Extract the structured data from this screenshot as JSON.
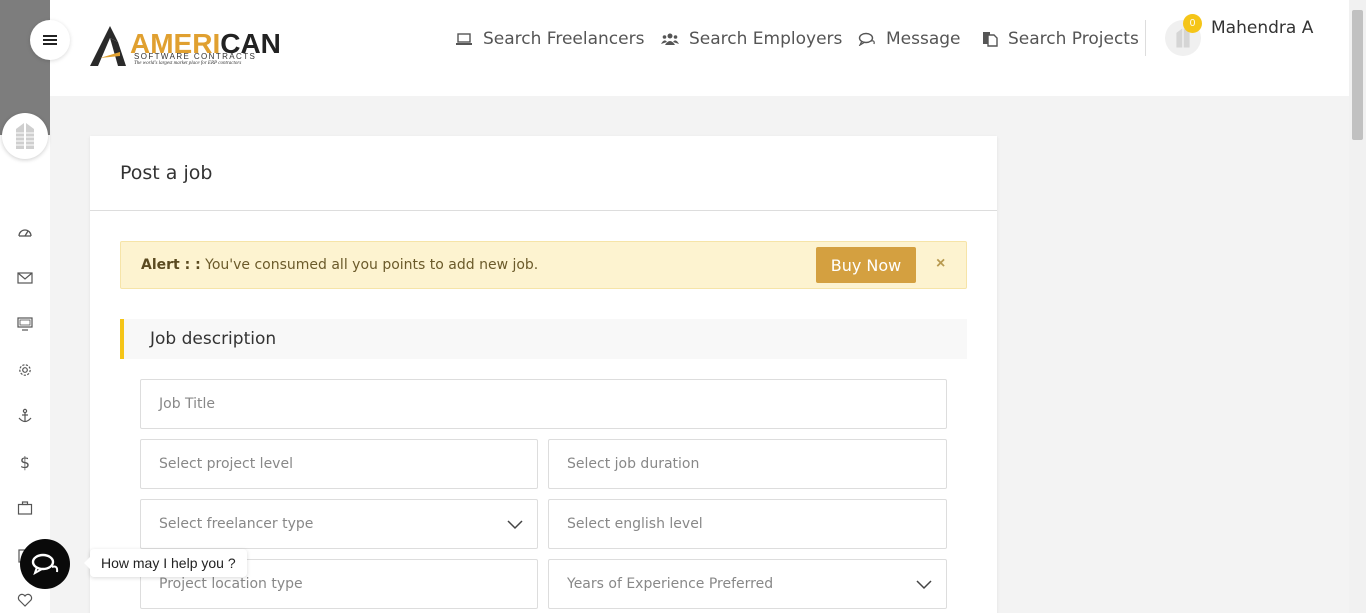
{
  "header": {
    "logo": {
      "brand_prefix": "AMERI",
      "brand_suffix": "CAN",
      "subtitle": "SOFTWARE CONTRACTS",
      "tagline": "The world's largest market place for ERP contractors"
    },
    "nav": [
      {
        "label": "Search Freelancers",
        "icon": "laptop-icon"
      },
      {
        "label": "Search Employers",
        "icon": "users-icon"
      },
      {
        "label": "Message",
        "icon": "chat-icon"
      },
      {
        "label": "Search Projects",
        "icon": "documents-icon"
      }
    ],
    "notification_count": "0",
    "user_name": "Mahendra A"
  },
  "sidebar": {
    "icons": [
      "dashboard-icon",
      "mail-icon",
      "monitor-icon",
      "gear-icon",
      "anchor-icon",
      "dollar-icon",
      "briefcase-icon",
      "document-icon",
      "heart-icon"
    ]
  },
  "card": {
    "title": "Post a job",
    "alert": {
      "prefix": "Alert : :",
      "message": "You've consumed all you points to add new job.",
      "button": "Buy Now",
      "close": "×"
    },
    "section_title": "Job description",
    "fields": {
      "job_title": "Job Title",
      "project_level": "Select project level",
      "job_duration": "Select job duration",
      "freelancer_type": "Select freelancer type",
      "english_level": "Select english level",
      "location_type": "Project location type",
      "experience": "Years of Experience Preferred"
    }
  },
  "chat": {
    "prompt": "How may I help you ?"
  },
  "colors": {
    "accent": "#f5c518",
    "button": "#d4a040",
    "alert_bg": "#fdf3d0"
  }
}
